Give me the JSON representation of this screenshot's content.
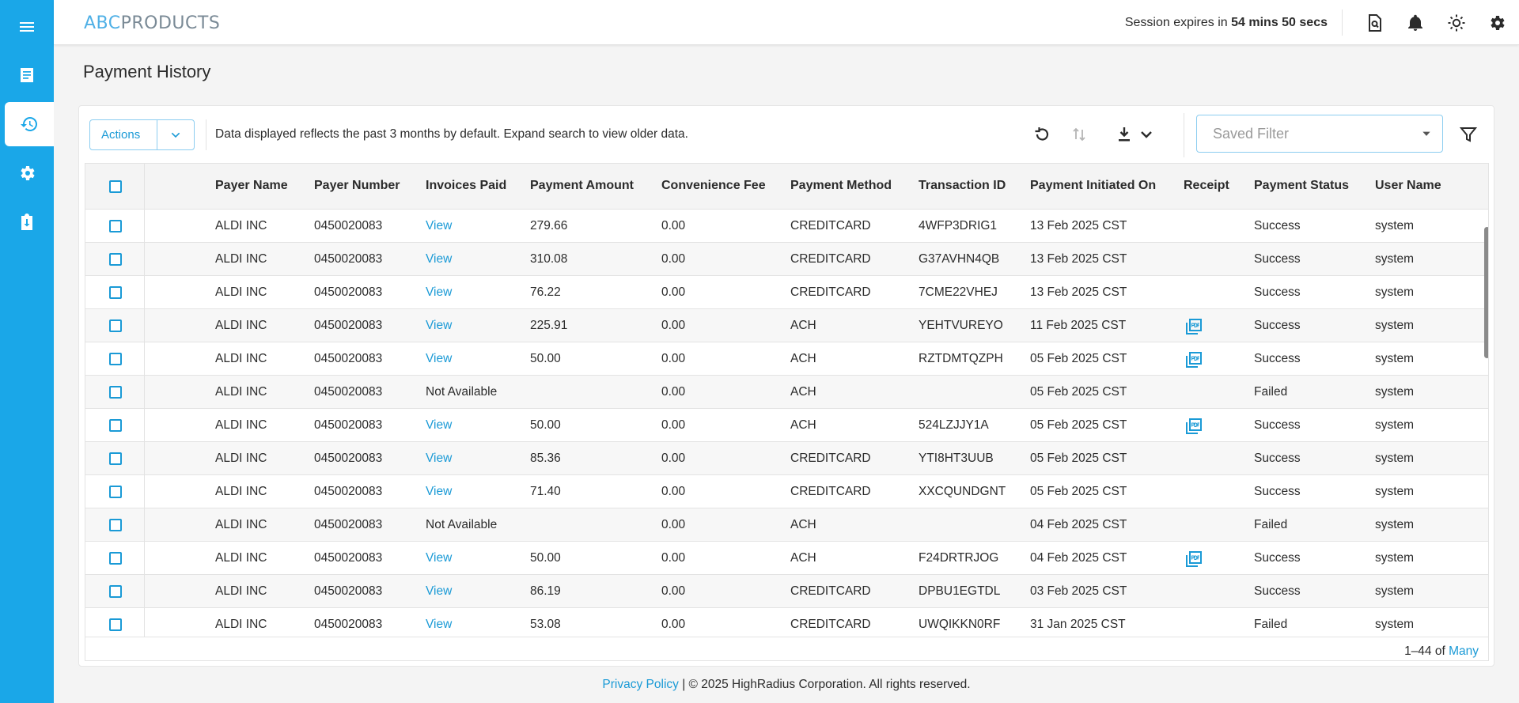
{
  "colors": {
    "brand": "#1aa7e8",
    "link": "#1a9ad6",
    "failed": "#2b2b2b"
  },
  "sidebar": {
    "items": [
      {
        "icon": "menu-icon"
      },
      {
        "icon": "document-icon"
      },
      {
        "icon": "history-icon",
        "active": true
      },
      {
        "icon": "gear-icon"
      },
      {
        "icon": "clipboard-download-icon"
      }
    ]
  },
  "header": {
    "logo_prefix": "ABC",
    "logo_suffix": "PRODUCTS",
    "session_prefix": "Session expires in",
    "session_time": "54 mins 50 secs",
    "icons": [
      "document-search-icon",
      "bell-icon",
      "sun-icon",
      "settings-icon"
    ]
  },
  "page": {
    "title": "Payment History"
  },
  "toolbar": {
    "actions_label": "Actions",
    "info": "Data displayed reflects the past 3 months by default. Expand search to view older data.",
    "saved_filter_placeholder": "Saved Filter"
  },
  "table": {
    "columns": [
      "Payer Name",
      "Payer Number",
      "Invoices Paid",
      "Payment Amount",
      "Convenience Fee",
      "Payment Method",
      "Transaction ID",
      "Payment Initiated On",
      "Receipt",
      "Payment Status",
      "User Name"
    ],
    "rows": [
      {
        "payer": "ALDI INC",
        "number": "0450020083",
        "invoices": "View",
        "amount": "279.66",
        "fee": "0.00",
        "method": "CREDITCARD",
        "txn": "4WFP3DRIG1",
        "date": "13 Feb 2025 CST",
        "receipt": false,
        "status": "Success",
        "user": "system"
      },
      {
        "payer": "ALDI INC",
        "number": "0450020083",
        "invoices": "View",
        "amount": "310.08",
        "fee": "0.00",
        "method": "CREDITCARD",
        "txn": "G37AVHN4QB",
        "date": "13 Feb 2025 CST",
        "receipt": false,
        "status": "Success",
        "user": "system"
      },
      {
        "payer": "ALDI INC",
        "number": "0450020083",
        "invoices": "View",
        "amount": "76.22",
        "fee": "0.00",
        "method": "CREDITCARD",
        "txn": "7CME22VHEJ",
        "date": "13 Feb 2025 CST",
        "receipt": false,
        "status": "Success",
        "user": "system"
      },
      {
        "payer": "ALDI INC",
        "number": "0450020083",
        "invoices": "View",
        "amount": "225.91",
        "fee": "0.00",
        "method": "ACH",
        "txn": "YEHTVUREYO",
        "date": "11 Feb 2025 CST",
        "receipt": true,
        "status": "Success",
        "user": "system"
      },
      {
        "payer": "ALDI INC",
        "number": "0450020083",
        "invoices": "View",
        "amount": "50.00",
        "fee": "0.00",
        "method": "ACH",
        "txn": "RZTDMTQZPH",
        "date": "05 Feb 2025 CST",
        "receipt": true,
        "status": "Success",
        "user": "system"
      },
      {
        "payer": "ALDI INC",
        "number": "0450020083",
        "invoices": "Not Available",
        "amount": "",
        "fee": "0.00",
        "method": "ACH",
        "txn": "",
        "date": "05 Feb 2025 CST",
        "receipt": false,
        "status": "Failed",
        "user": "system"
      },
      {
        "payer": "ALDI INC",
        "number": "0450020083",
        "invoices": "View",
        "amount": "50.00",
        "fee": "0.00",
        "method": "ACH",
        "txn": "524LZJJY1A",
        "date": "05 Feb 2025 CST",
        "receipt": true,
        "status": "Success",
        "user": "system"
      },
      {
        "payer": "ALDI INC",
        "number": "0450020083",
        "invoices": "View",
        "amount": "85.36",
        "fee": "0.00",
        "method": "CREDITCARD",
        "txn": "YTI8HT3UUB",
        "date": "05 Feb 2025 CST",
        "receipt": false,
        "status": "Success",
        "user": "system"
      },
      {
        "payer": "ALDI INC",
        "number": "0450020083",
        "invoices": "View",
        "amount": "71.40",
        "fee": "0.00",
        "method": "CREDITCARD",
        "txn": "XXCQUNDGNT",
        "date": "05 Feb 2025 CST",
        "receipt": false,
        "status": "Success",
        "user": "system"
      },
      {
        "payer": "ALDI INC",
        "number": "0450020083",
        "invoices": "Not Available",
        "amount": "",
        "fee": "0.00",
        "method": "ACH",
        "txn": "",
        "date": "04 Feb 2025 CST",
        "receipt": false,
        "status": "Failed",
        "user": "system"
      },
      {
        "payer": "ALDI INC",
        "number": "0450020083",
        "invoices": "View",
        "amount": "50.00",
        "fee": "0.00",
        "method": "ACH",
        "txn": "F24DRTRJOG",
        "date": "04 Feb 2025 CST",
        "receipt": true,
        "status": "Success",
        "user": "system"
      },
      {
        "payer": "ALDI INC",
        "number": "0450020083",
        "invoices": "View",
        "amount": "86.19",
        "fee": "0.00",
        "method": "CREDITCARD",
        "txn": "DPBU1EGTDL",
        "date": "03 Feb 2025 CST",
        "receipt": false,
        "status": "Success",
        "user": "system"
      },
      {
        "payer": "ALDI INC",
        "number": "0450020083",
        "invoices": "View",
        "amount": "53.08",
        "fee": "0.00",
        "method": "CREDITCARD",
        "txn": "UWQIKKN0RF",
        "date": "31 Jan 2025 CST",
        "receipt": false,
        "status": "Failed",
        "user": "system"
      }
    ]
  },
  "pagination": {
    "range": "1–44 of",
    "total": "Many"
  },
  "footer": {
    "privacy": "Privacy Policy",
    "copyright": " | © 2025 HighRadius Corporation. All rights reserved."
  }
}
